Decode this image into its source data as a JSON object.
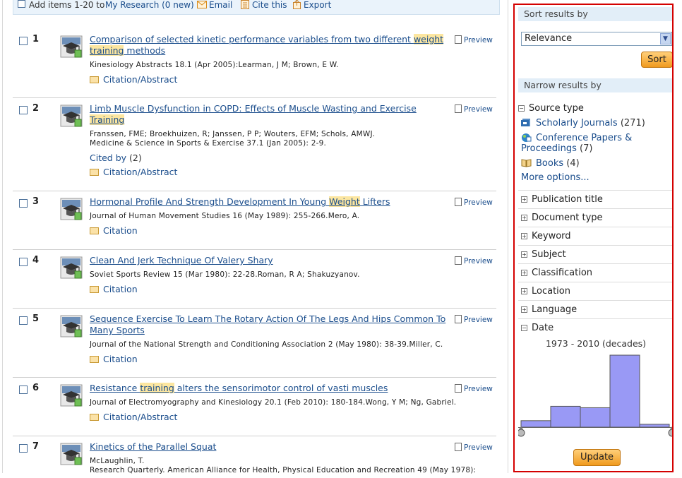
{
  "toolbar": {
    "add_text": "Add items 1-20 to",
    "my_research": "My Research (0 new)",
    "email": "Email",
    "cite": "Cite this",
    "export": "Export"
  },
  "results": [
    {
      "num": "1",
      "title_parts": [
        "Comparison of selected kinetic performance variables from two different ",
        "weight",
        " ",
        "training",
        " methods"
      ],
      "meta": [
        "Kinesiology Abstracts 18.1 (Apr 2005):Learman, J M; Brown, E W."
      ],
      "link": "Citation/Abstract",
      "preview": "Preview"
    },
    {
      "num": "2",
      "title_parts": [
        "Limb Muscle Dysfunction in COPD: Effects of Muscle Wasting and Exercise ",
        "Training"
      ],
      "meta": [
        "Franssen, FME; Broekhuizen, R; Janssen, P P; Wouters, EFM; Schols, AMWJ.",
        "Medicine & Science in Sports & Exercise 37.1 (Jan 2005): 2-9."
      ],
      "cited_label": "Cited by",
      "cited_count": "(2)",
      "link": "Citation/Abstract",
      "preview": "Preview"
    },
    {
      "num": "3",
      "title_parts": [
        "Hormonal Profile And Strength Development In Young ",
        "Weight",
        " Lifters"
      ],
      "meta": [
        "Journal of Human Movement Studies 16  (May 1989): 255-266.Mero, A."
      ],
      "link": "Citation",
      "preview": "Preview"
    },
    {
      "num": "4",
      "title_parts": [
        "Clean And Jerk Technique Of Valery Shary"
      ],
      "meta": [
        "Soviet Sports Review 15  (Mar 1980): 22-28.Roman, R A; Shakuzyanov."
      ],
      "link": "Citation",
      "preview": "Preview"
    },
    {
      "num": "5",
      "title_parts": [
        "Sequence Exercise To Learn The Rotary Action Of The Legs And Hips Common To Many Sports"
      ],
      "meta": [
        "Journal of the National Strength and Conditioning Association 2  (May 1980): 38-39.Miller, C."
      ],
      "link": "Citation",
      "preview": "Preview"
    },
    {
      "num": "6",
      "title_parts": [
        "Resistance ",
        "training",
        " alters the sensorimotor control of vasti muscles"
      ],
      "meta": [
        "Journal of Electromyography and Kinesiology 20.1 (Feb 2010): 180-184.Wong, Y M; Ng, Gabriel."
      ],
      "link": "Citation/Abstract",
      "preview": "Preview"
    },
    {
      "num": "7",
      "title_parts": [
        "Kinetics of the Parallel Squat"
      ],
      "meta": [
        "McLaughlin, T.",
        "Research Quarterly. American Alliance for Health, Physical Education and Recreation 49  (May 1978):"
      ],
      "link": "",
      "preview": "Preview"
    }
  ],
  "panel": {
    "sort_heading": "Sort results by",
    "sort_value": "Relevance",
    "sort_button": "Sort",
    "narrow_heading": "Narrow results by",
    "source_type_label": "Source type",
    "source_types": [
      {
        "label": "Scholarly Journals",
        "count": "(271)"
      },
      {
        "label": "Conference Papers & Proceedings",
        "count": "(7)"
      },
      {
        "label": "Books",
        "count": "(4)"
      }
    ],
    "more_options": "More options...",
    "facets": [
      "Publication title",
      "Document type",
      "Keyword",
      "Subject",
      "Classification",
      "Location",
      "Language"
    ],
    "date_label": "Date",
    "date_range": "1973 - 2010 (decades)",
    "date_bars": [
      0.09,
      0.29,
      0.27,
      1.0,
      0.04
    ],
    "update_button": "Update",
    "colors": {
      "accent_border": "#d40000",
      "bar_fill": "#9999f5",
      "button": "#f4a430"
    }
  }
}
